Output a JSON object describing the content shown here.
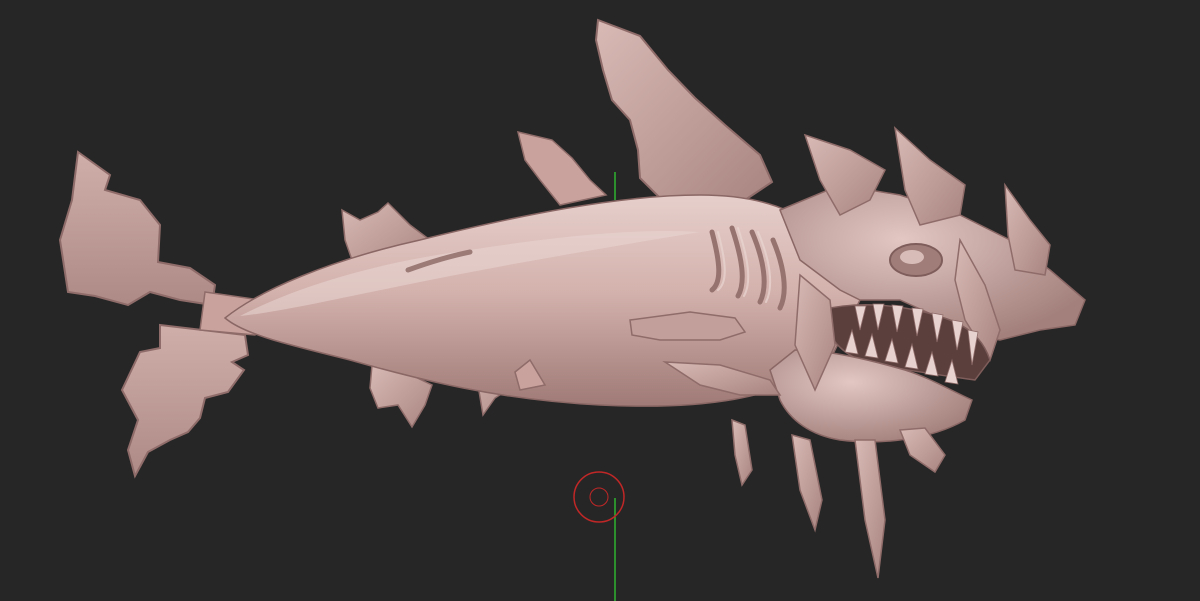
{
  "viewport": {
    "background": "#262626",
    "model_name": "",
    "model_color": "#c9a29d",
    "model_shadow": "#8f6c69",
    "model_highlight": "#e8d2cf"
  },
  "gizmo": {
    "y_axis_color": "#2fb42f",
    "pivot_color": "#c02727",
    "pivot_icon": "pivot-ring-icon"
  }
}
